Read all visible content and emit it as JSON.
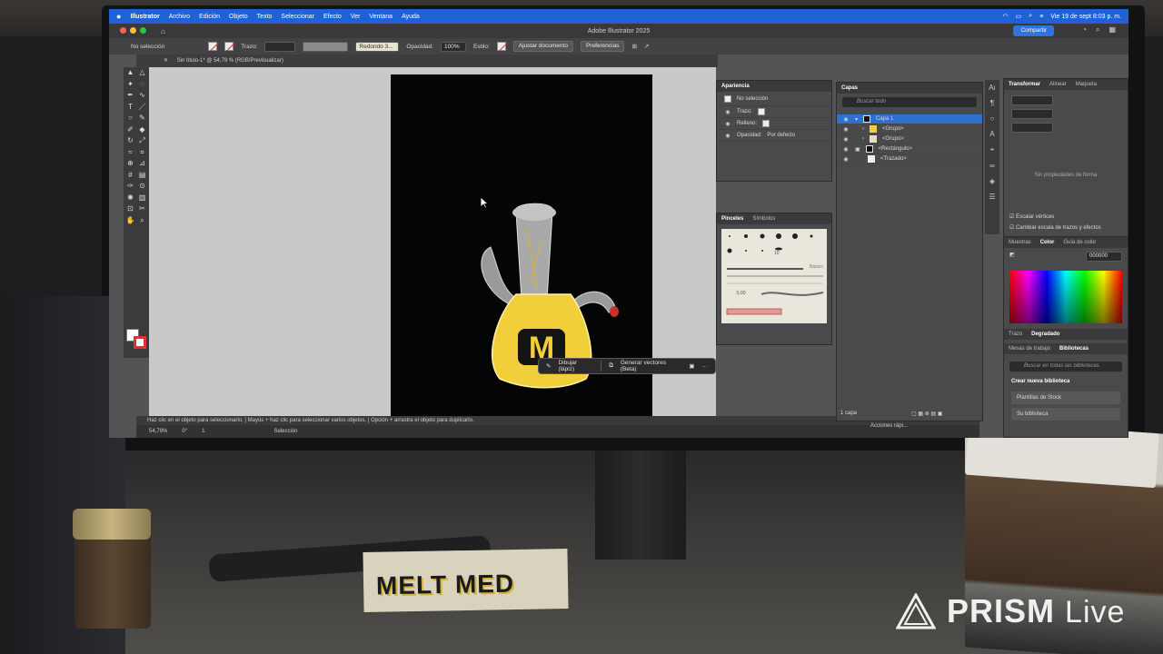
{
  "menubar": {
    "apple": "",
    "app": "Illustrator",
    "items": [
      "Archivo",
      "Edición",
      "Objeto",
      "Texto",
      "Seleccionar",
      "Efecto",
      "Ver",
      "Ventana",
      "Ayuda"
    ],
    "clock": "Vie 19 de sept 8:03 p. m."
  },
  "window": {
    "title": "Adobe Illustrator 2025",
    "share_label": "Compartir"
  },
  "controlbar": {
    "selection": "No selección",
    "stroke_label": "Trazo:",
    "brush_value": "Redondo 3...",
    "opacity_label": "Opacidad:",
    "opacity_value": "100%",
    "style_label": "Estilo:",
    "fit_button": "Ajustar documento",
    "prefs_button": "Preferencias"
  },
  "document_tab": {
    "close": "✕",
    "label": "Sin título-1* @ 54,79 % (RGB/Previsualizar)"
  },
  "artwork": {
    "letter": "M"
  },
  "context_bar": {
    "draw_label": "Dibujar (lápiz)",
    "generate_label": "Generar vectores (Beta)",
    "more": "···"
  },
  "statusbar": {
    "hint": "Haz clic en el objeto para seleccionarlo.  |  Mayús + haz clic para seleccionar varios objetos.  |  Opción + arrastra el objeto para duplicarlo."
  },
  "infobar": {
    "zoom": "54,79%",
    "angle": "0°",
    "artboard": "1",
    "tool": "Selección"
  },
  "appearance_panel": {
    "tab": "Apariencia",
    "selection": "No selección",
    "rows": [
      {
        "label": "Trazo:"
      },
      {
        "label": "Relleno:"
      },
      {
        "label": "Opacidad:",
        "value": "Por defecto"
      }
    ]
  },
  "brushes_panel": {
    "tabs": [
      "Pinceles",
      "Símbolos"
    ],
    "basic_label": "Básico",
    "size_label": "3,00",
    "small_value": "10"
  },
  "layers_panel": {
    "tab": "Capas",
    "search_placeholder": "Buscar todo",
    "rows": [
      {
        "name": "Capa 1"
      },
      {
        "name": "<Grupo>"
      },
      {
        "name": "<Grupo>"
      },
      {
        "name": "<Rectángulo>"
      },
      {
        "name": "<Trazado>"
      }
    ],
    "footer": "1 capa",
    "actions": "Acciones rápi..."
  },
  "properties_panel": {
    "tabs": [
      "Transformar",
      "Alinear",
      "Maqueta"
    ],
    "empty": "Sin propiedades de forma",
    "checkbox1": "Escalar vértices",
    "checkbox2": "Cambiar escala de trazos y efectos"
  },
  "color_panel": {
    "tabs": [
      "Muestras",
      "Color",
      "Guía de color"
    ],
    "hex": "000000",
    "sub_tabs": [
      "Trazo",
      "Degradado"
    ],
    "lib_tabs": [
      "Mesas de trabajo",
      "Bibliotecas"
    ],
    "lib_search": "Buscar en todas las bibliotecas",
    "create_lib": "Crear nueva biblioteca",
    "stock": "Plantillas de Stock",
    "your_lib": "Su biblioteca"
  },
  "desk": {
    "sticker_text": "MELT MED"
  },
  "watermark": {
    "brand": "PRISM",
    "suffix": "Live"
  },
  "colors": {
    "menubar": "#2062d6",
    "share": "#2f73e0",
    "selection": "#2f6fd0",
    "artwork_yellow": "#f1cf3b"
  }
}
